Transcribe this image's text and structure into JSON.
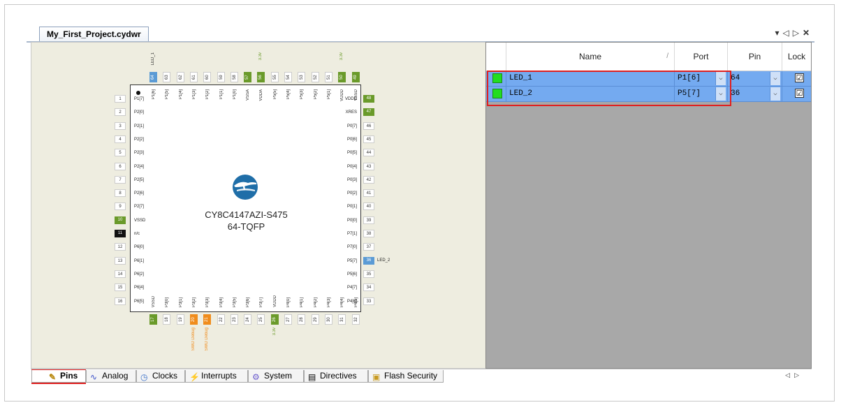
{
  "document_tab": {
    "title": "My_First_Project.cydwr"
  },
  "window_controls": {
    "dropdown": "▾",
    "prev": "◁",
    "next": "▷",
    "close": "✕"
  },
  "chip": {
    "part_number": "CY8C4147AZI-S475",
    "package": "64-TQFP",
    "left_pins": [
      {
        "num": "1",
        "label": "P1[7]",
        "color": "#ffffff"
      },
      {
        "num": "2",
        "label": "P2[0]",
        "color": "#ffffff"
      },
      {
        "num": "3",
        "label": "P2[1]",
        "color": "#ffffff"
      },
      {
        "num": "4",
        "label": "P2[2]",
        "color": "#ffffff"
      },
      {
        "num": "5",
        "label": "P2[3]",
        "color": "#ffffff"
      },
      {
        "num": "6",
        "label": "P2[4]",
        "color": "#ffffff"
      },
      {
        "num": "7",
        "label": "P2[5]",
        "color": "#ffffff"
      },
      {
        "num": "8",
        "label": "P2[6]",
        "color": "#ffffff"
      },
      {
        "num": "9",
        "label": "P2[7]",
        "color": "#ffffff"
      },
      {
        "num": "10",
        "label": "VSSD",
        "color": "#6a9a2a"
      },
      {
        "num": "11",
        "label": "n/c",
        "color": "#111111"
      },
      {
        "num": "12",
        "label": "P6[0]",
        "color": "#ffffff"
      },
      {
        "num": "13",
        "label": "P6[1]",
        "color": "#ffffff"
      },
      {
        "num": "14",
        "label": "P6[2]",
        "color": "#ffffff"
      },
      {
        "num": "15",
        "label": "P6[4]",
        "color": "#ffffff"
      },
      {
        "num": "16",
        "label": "P6[5]",
        "color": "#ffffff"
      }
    ],
    "right_pins": [
      {
        "num": "48",
        "label": "VDDD",
        "color": "#6a9a2a",
        "note": ""
      },
      {
        "num": "47",
        "label": "XRES",
        "color": "#6a9a2a",
        "note": ""
      },
      {
        "num": "46",
        "label": "P0[7]",
        "color": "#ffffff",
        "note": ""
      },
      {
        "num": "45",
        "label": "P0[6]",
        "color": "#ffffff",
        "note": ""
      },
      {
        "num": "44",
        "label": "P0[5]",
        "color": "#ffffff",
        "note": ""
      },
      {
        "num": "43",
        "label": "P0[4]",
        "color": "#ffffff",
        "note": ""
      },
      {
        "num": "42",
        "label": "P0[3]",
        "color": "#ffffff",
        "note": ""
      },
      {
        "num": "41",
        "label": "P0[2]",
        "color": "#ffffff",
        "note": ""
      },
      {
        "num": "40",
        "label": "P0[1]",
        "color": "#ffffff",
        "note": ""
      },
      {
        "num": "39",
        "label": "P0[0]",
        "color": "#ffffff",
        "note": ""
      },
      {
        "num": "38",
        "label": "P7[1]",
        "color": "#ffffff",
        "note": ""
      },
      {
        "num": "37",
        "label": "P7[0]",
        "color": "#ffffff",
        "note": ""
      },
      {
        "num": "36",
        "label": "P5[7]",
        "color": "#5b9bd5",
        "note": "LED_2"
      },
      {
        "num": "35",
        "label": "P5[6]",
        "color": "#ffffff",
        "note": ""
      },
      {
        "num": "34",
        "label": "P4[7]",
        "color": "#ffffff",
        "note": ""
      },
      {
        "num": "33",
        "label": "P4[6]",
        "color": "#ffffff",
        "note": ""
      }
    ],
    "top_pins": [
      {
        "num": "64",
        "label": "P1[6]",
        "color": "#5b9bd5",
        "note": "LED_1",
        "note_color": "#222222"
      },
      {
        "num": "63",
        "label": "P1[5]",
        "color": "#ffffff",
        "note": "",
        "note_color": ""
      },
      {
        "num": "62",
        "label": "P1[4]",
        "color": "#ffffff",
        "note": "",
        "note_color": ""
      },
      {
        "num": "61",
        "label": "P1[3]",
        "color": "#ffffff",
        "note": "",
        "note_color": ""
      },
      {
        "num": "60",
        "label": "P1[2]",
        "color": "#ffffff",
        "note": "",
        "note_color": ""
      },
      {
        "num": "59",
        "label": "P1[1]",
        "color": "#ffffff",
        "note": "",
        "note_color": ""
      },
      {
        "num": "58",
        "label": "P1[0]",
        "color": "#ffffff",
        "note": "",
        "note_color": ""
      },
      {
        "num": "57",
        "label": "VSSA",
        "color": "#6a9a2a",
        "note": "",
        "note_color": ""
      },
      {
        "num": "56",
        "label": "VDDA",
        "color": "#6a9a2a",
        "note": "3.3v",
        "note_color": "#6a9a2a"
      },
      {
        "num": "55",
        "label": "P5[5]",
        "color": "#ffffff",
        "note": "",
        "note_color": ""
      },
      {
        "num": "54",
        "label": "P5[4]",
        "color": "#ffffff",
        "note": "",
        "note_color": ""
      },
      {
        "num": "53",
        "label": "P5[3]",
        "color": "#ffffff",
        "note": "",
        "note_color": ""
      },
      {
        "num": "52",
        "label": "P5[2]",
        "color": "#ffffff",
        "note": "",
        "note_color": ""
      },
      {
        "num": "51",
        "label": "P5[1]",
        "color": "#ffffff",
        "note": "",
        "note_color": ""
      },
      {
        "num": "50",
        "label": "VDDD",
        "color": "#6a9a2a",
        "note": "3.3v",
        "note_color": "#6a9a2a"
      },
      {
        "num": "49",
        "label": "VSSD",
        "color": "#6a9a2a",
        "note": "",
        "note_color": ""
      }
    ],
    "bottom_pins": [
      {
        "num": "17",
        "label": "VSSD",
        "color": "#6a9a2a",
        "note": "",
        "note_color": ""
      },
      {
        "num": "18",
        "label": "P3[0]",
        "color": "#ffffff",
        "note": "",
        "note_color": ""
      },
      {
        "num": "19",
        "label": "P3[1]",
        "color": "#ffffff",
        "note": "",
        "note_color": ""
      },
      {
        "num": "20",
        "label": "P3[2]",
        "color": "#f08c1c",
        "note": "SWD Debug",
        "note_color": "#f08c1c"
      },
      {
        "num": "21",
        "label": "P3[3]",
        "color": "#f08c1c",
        "note": "SWD Debug",
        "note_color": "#f08c1c"
      },
      {
        "num": "22",
        "label": "P3[4]",
        "color": "#ffffff",
        "note": "",
        "note_color": ""
      },
      {
        "num": "23",
        "label": "P3[5]",
        "color": "#ffffff",
        "note": "",
        "note_color": ""
      },
      {
        "num": "24",
        "label": "P3[6]",
        "color": "#ffffff",
        "note": "",
        "note_color": ""
      },
      {
        "num": "25",
        "label": "P3[7]",
        "color": "#ffffff",
        "note": "",
        "note_color": ""
      },
      {
        "num": "26",
        "label": "VDDD",
        "color": "#6a9a2a",
        "note": "3.3v",
        "note_color": "#6a9a2a"
      },
      {
        "num": "27",
        "label": "P4[0]",
        "color": "#ffffff",
        "note": "",
        "note_color": ""
      },
      {
        "num": "28",
        "label": "P4[1]",
        "color": "#ffffff",
        "note": "",
        "note_color": ""
      },
      {
        "num": "29",
        "label": "P4[2]",
        "color": "#ffffff",
        "note": "",
        "note_color": ""
      },
      {
        "num": "30",
        "label": "P4[3]",
        "color": "#ffffff",
        "note": "",
        "note_color": ""
      },
      {
        "num": "31",
        "label": "P4[4]",
        "color": "#ffffff",
        "note": "",
        "note_color": ""
      },
      {
        "num": "32",
        "label": "P4[5]",
        "color": "#ffffff",
        "note": "",
        "note_color": ""
      }
    ]
  },
  "pin_table": {
    "headers": {
      "name": "Name",
      "port": "Port",
      "pin": "Pin",
      "lock": "Lock"
    },
    "rows": [
      {
        "name": "LED_1",
        "port": "P1[6]",
        "pin": "64",
        "locked": "☑",
        "swatch_color": "#22dd22"
      },
      {
        "name": "LED_2",
        "port": "P5[7]",
        "pin": "36",
        "locked": "☑",
        "swatch_color": "#22dd22"
      }
    ]
  },
  "bottom_tabs": [
    {
      "label": "Pins",
      "icon": "pins-icon",
      "glyph": "✎"
    },
    {
      "label": "Analog",
      "icon": "analog-icon",
      "glyph": "∿"
    },
    {
      "label": "Clocks",
      "icon": "clock-icon",
      "glyph": "◷"
    },
    {
      "label": "Interrupts",
      "icon": "interrupt-icon",
      "glyph": "⚡"
    },
    {
      "label": "System",
      "icon": "system-icon",
      "glyph": "⚙"
    },
    {
      "label": "Directives",
      "icon": "directives-icon",
      "glyph": "▤"
    },
    {
      "label": "Flash Security",
      "icon": "flash-security-icon",
      "glyph": "▣"
    }
  ],
  "bottom_nav": {
    "prev": "◁",
    "next": "▷"
  },
  "colors": {
    "selection": "#74aaf0",
    "highlight_red": "#e02020",
    "power_pin": "#6a9a2a",
    "debug_pin": "#f08c1c",
    "assigned_pin": "#5b9bd5"
  }
}
